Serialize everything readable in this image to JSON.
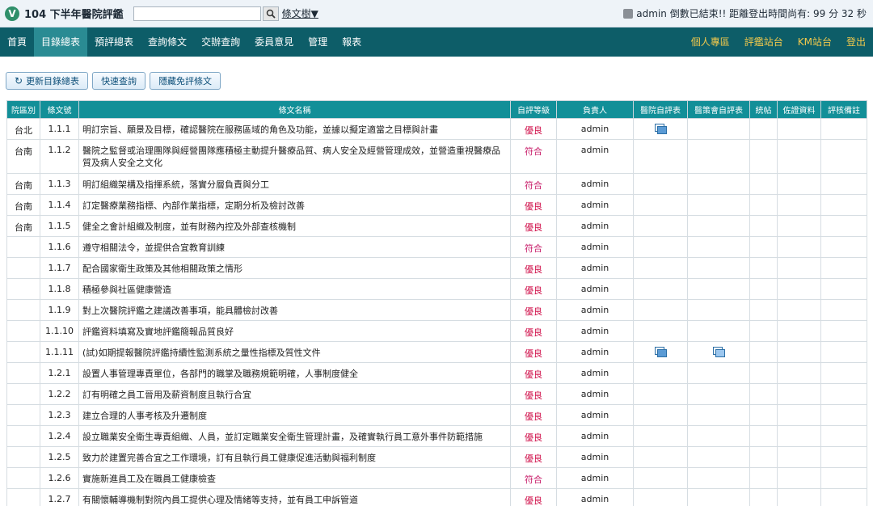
{
  "header": {
    "logo": "V",
    "title": "104 下半年醫院評鑑",
    "search_value": "",
    "tree_link": "條文樹▼",
    "user_status": "admin 倒數已結束!! 距離登出時間尚有: 99 分 32 秒"
  },
  "nav": {
    "left": [
      "首頁",
      "目錄總表",
      "預評總表",
      "查詢條文",
      "交辦查詢",
      "委員意見",
      "管理",
      "報表"
    ],
    "active": "目錄總表",
    "right": [
      "個人專區",
      "評鑑站台",
      "KM站台",
      "登出"
    ]
  },
  "toolbar": {
    "refresh": "更新目錄總表",
    "quick_search": "快速查詢",
    "hide_exempt": "隱藏免評條文"
  },
  "table": {
    "headers": [
      "院區別",
      "條文號",
      "條文名稱",
      "自評等級",
      "負責人",
      "醫院自評表",
      "醫策會自評表",
      "統帖",
      "佐證資料",
      "評核備註"
    ],
    "rows": [
      {
        "campus": "台北",
        "no": "1.1.1",
        "name": "明訂宗旨、願景及目標，確認醫院在服務區域的角色及功能，並據以擬定適當之目標與計畫",
        "grade": "優良",
        "owner": "admin",
        "hosp": true,
        "jcq": false
      },
      {
        "campus": "台南",
        "no": "1.1.2",
        "name": "醫院之監督或治理團隊與經營團隊應積極主動提升醫療品質、病人安全及經營管理成效，並營造重視醫療品質及病人安全之文化",
        "grade": "符合",
        "owner": "admin",
        "hosp": false,
        "jcq": false
      },
      {
        "campus": "台南",
        "no": "1.1.3",
        "name": "明訂組織架構及指揮系統，落實分層負責與分工",
        "grade": "符合",
        "owner": "admin",
        "hosp": false,
        "jcq": false
      },
      {
        "campus": "台南",
        "no": "1.1.4",
        "name": "訂定醫療業務指標、內部作業指標，定期分析及檢討改善",
        "grade": "優良",
        "owner": "admin",
        "hosp": false,
        "jcq": false
      },
      {
        "campus": "台南",
        "no": "1.1.5",
        "name": "健全之會計組織及制度，並有財務內控及外部查核機制",
        "grade": "優良",
        "owner": "admin",
        "hosp": false,
        "jcq": false
      },
      {
        "campus": "",
        "no": "1.1.6",
        "name": "遵守相關法令，並提供合宜教育訓練",
        "grade": "符合",
        "owner": "admin",
        "hosp": false,
        "jcq": false
      },
      {
        "campus": "",
        "no": "1.1.7",
        "name": "配合國家衛生政策及其他相關政策之情形",
        "grade": "優良",
        "owner": "admin",
        "hosp": false,
        "jcq": false
      },
      {
        "campus": "",
        "no": "1.1.8",
        "name": "積極參與社區健康營造",
        "grade": "優良",
        "owner": "admin",
        "hosp": false,
        "jcq": false
      },
      {
        "campus": "",
        "no": "1.1.9",
        "name": "對上次醫院評鑑之建議改善事項，能具體檢討改善",
        "grade": "優良",
        "owner": "admin",
        "hosp": false,
        "jcq": false
      },
      {
        "campus": "",
        "no": "1.1.10",
        "name": "評鑑資料填寫及實地評鑑簡報品質良好",
        "grade": "優良",
        "owner": "admin",
        "hosp": false,
        "jcq": false
      },
      {
        "campus": "",
        "no": "1.1.11",
        "name": "(試)如期提報醫院評鑑持續性監測系統之量性指標及質性文件",
        "grade": "優良",
        "owner": "admin",
        "hosp": true,
        "jcq": true
      },
      {
        "campus": "",
        "no": "1.2.1",
        "name": "設置人事管理專責單位，各部門的職掌及職務規範明確，人事制度健全",
        "grade": "優良",
        "owner": "admin",
        "hosp": false,
        "jcq": false
      },
      {
        "campus": "",
        "no": "1.2.2",
        "name": "訂有明確之員工晉用及薪資制度且執行合宜",
        "grade": "優良",
        "owner": "admin",
        "hosp": false,
        "jcq": false
      },
      {
        "campus": "",
        "no": "1.2.3",
        "name": "建立合理的人事考核及升遷制度",
        "grade": "優良",
        "owner": "admin",
        "hosp": false,
        "jcq": false
      },
      {
        "campus": "",
        "no": "1.2.4",
        "name": "設立職業安全衛生專責組織、人員，並訂定職業安全衛生管理計畫，及確實執行員工意外事件防範措施",
        "grade": "優良",
        "owner": "admin",
        "hosp": false,
        "jcq": false
      },
      {
        "campus": "",
        "no": "1.2.5",
        "name": "致力於建置完善合宜之工作環境，訂有且執行員工健康促進活動與福利制度",
        "grade": "優良",
        "owner": "admin",
        "hosp": false,
        "jcq": false
      },
      {
        "campus": "",
        "no": "1.2.6",
        "name": "實施新進員工及在職員工健康檢查",
        "grade": "符合",
        "owner": "admin",
        "hosp": false,
        "jcq": false
      },
      {
        "campus": "",
        "no": "1.2.7",
        "name": "有關懷輔導機制對院內員工提供心理及情緒等支持，並有員工申訴管道",
        "grade": "優良",
        "owner": "admin",
        "hosp": false,
        "jcq": false
      }
    ]
  },
  "colors": {
    "nav_bg": "#0d5d68",
    "nav_active": "#2a8b93",
    "table_header": "#128f98",
    "grade_text": "#d0104a",
    "nav_right_text": "#f2c94c"
  }
}
